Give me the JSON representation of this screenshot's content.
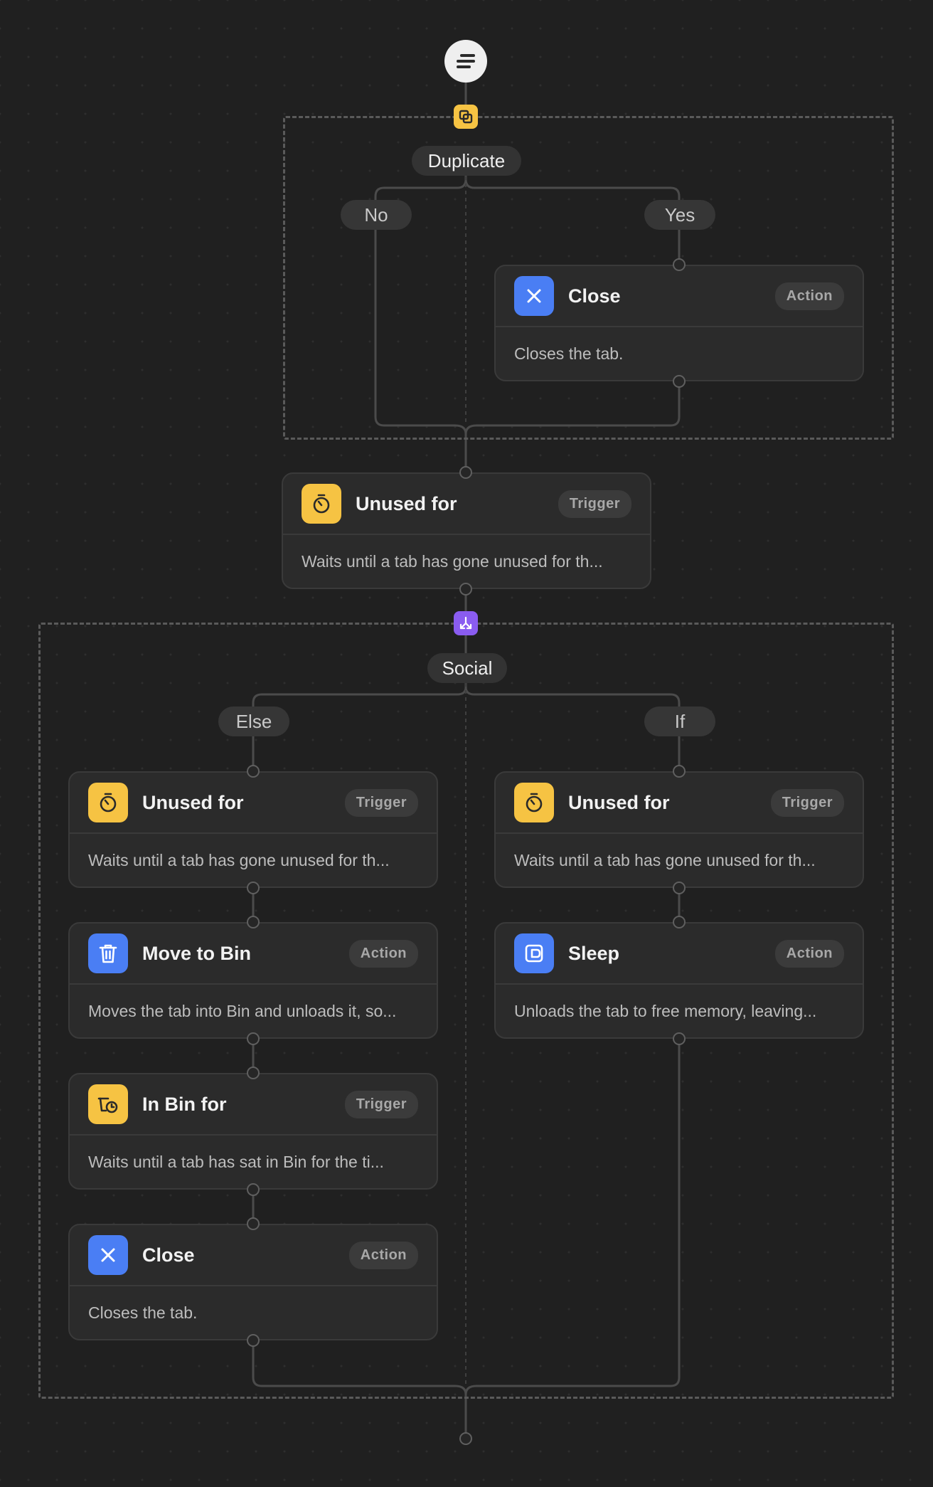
{
  "workflow": {
    "duplicate_group": {
      "label": "Duplicate",
      "branch_no": "No",
      "branch_yes": "Yes",
      "close_card": {
        "title": "Close",
        "tag": "Action",
        "description": "Closes the tab."
      }
    },
    "unused_card": {
      "title": "Unused for",
      "tag": "Trigger",
      "description": "Waits until a tab has gone unused for th..."
    },
    "social_group": {
      "label": "Social",
      "branch_else": "Else",
      "branch_if": "If",
      "else_unused": {
        "title": "Unused for",
        "tag": "Trigger",
        "description": "Waits until a tab has gone unused for th..."
      },
      "else_move": {
        "title": "Move to Bin",
        "tag": "Action",
        "description": "Moves the tab into Bin and unloads it, so..."
      },
      "else_inbin": {
        "title": "In Bin for",
        "tag": "Trigger",
        "description": "Waits until a tab has sat in Bin for the ti..."
      },
      "else_close": {
        "title": "Close",
        "tag": "Action",
        "description": "Closes the tab."
      },
      "if_unused": {
        "title": "Unused for",
        "tag": "Trigger",
        "description": "Waits until a tab has gone unused for th..."
      },
      "if_sleep": {
        "title": "Sleep",
        "tag": "Action",
        "description": "Unloads the tab to free memory, leaving..."
      }
    }
  },
  "colors": {
    "trigger_icon": "#f6c343",
    "action_icon": "#4a7ef4",
    "group_badge_duplicate": "#f6c343",
    "group_badge_social": "#8a5cf0"
  },
  "icons": {
    "root": "menu-lines-icon",
    "duplicate": "duplicate-icon",
    "social": "split-arrows-icon",
    "close": "x-icon",
    "unused": "stopwatch-icon",
    "move_to_bin": "trash-icon",
    "in_bin": "bin-clock-icon",
    "sleep": "sleep-icon"
  }
}
